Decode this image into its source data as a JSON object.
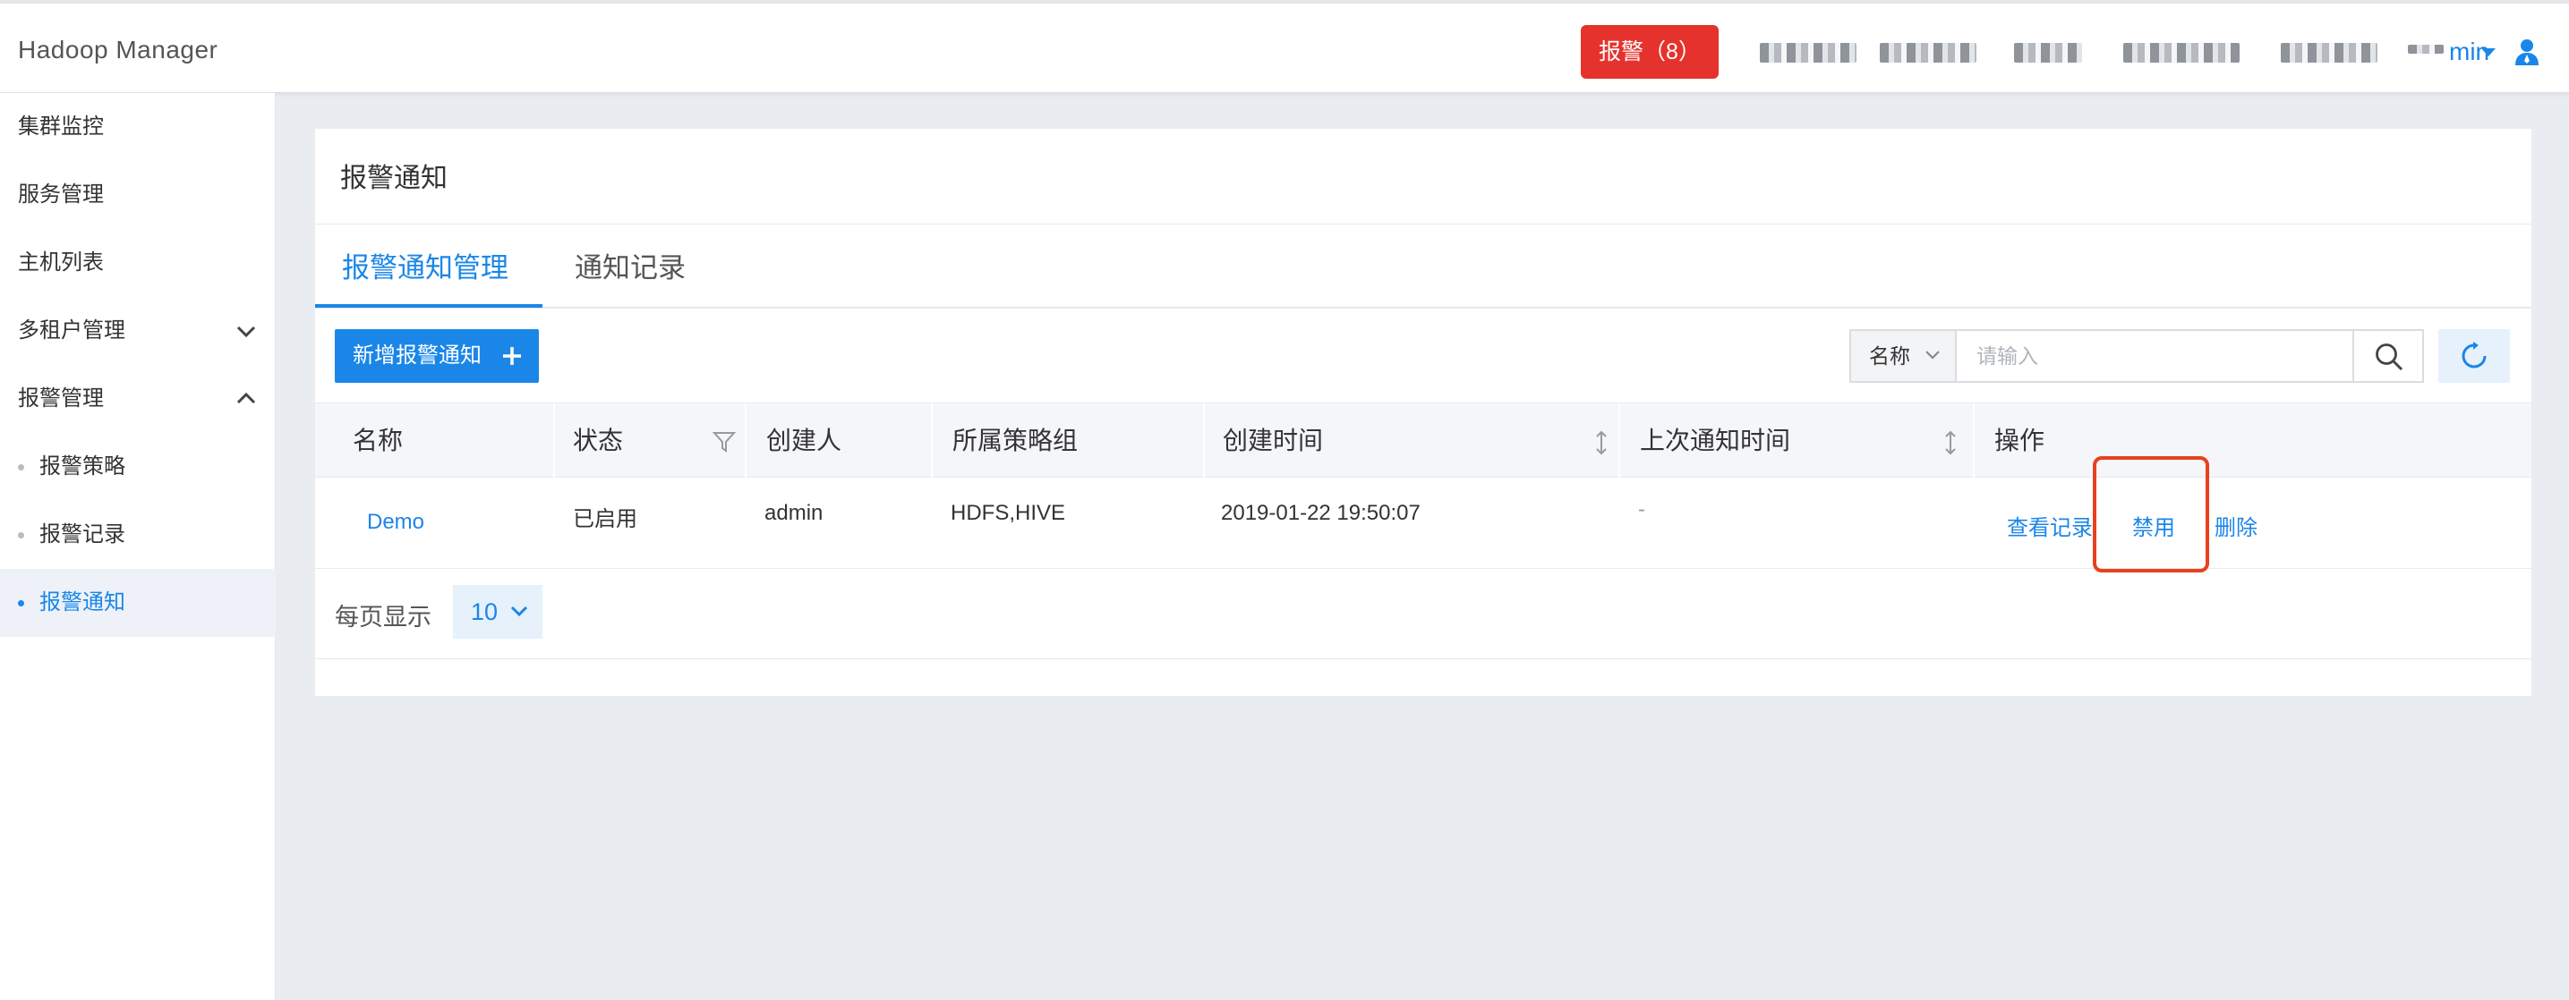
{
  "header": {
    "brand": "Hadoop Manager",
    "alarm_button": "报警（8）",
    "user_name": "min",
    "accent": "#1a86e8",
    "alarm_color": "#e5322d"
  },
  "sidebar": {
    "items": [
      {
        "label": "集群监控"
      },
      {
        "label": "服务管理"
      },
      {
        "label": "主机列表"
      },
      {
        "label": "多租户管理"
      },
      {
        "label": "报警管理"
      },
      {
        "label": "报警策略"
      },
      {
        "label": "报警记录"
      },
      {
        "label": "报警通知"
      }
    ]
  },
  "panel": {
    "title": "报警通知",
    "tabs": [
      {
        "label": "报警通知管理",
        "active": true
      },
      {
        "label": "通知记录",
        "active": false
      }
    ],
    "add_button": "新增报警通知",
    "search": {
      "field": "名称",
      "placeholder": "请输入"
    }
  },
  "table": {
    "headers": [
      "名称",
      "状态",
      "创建人",
      "所属策略组",
      "创建时间",
      "上次通知时间",
      "操作"
    ],
    "rows": [
      {
        "name": "Demo",
        "status": "已启用",
        "creator": "admin",
        "group": "HDFS,HIVE",
        "created": "2019-01-22 19:50:07",
        "last_notified": "-",
        "actions": [
          "查看记录",
          "禁用",
          "删除"
        ]
      }
    ]
  },
  "pager": {
    "label": "每页显示",
    "page_size": "10"
  }
}
